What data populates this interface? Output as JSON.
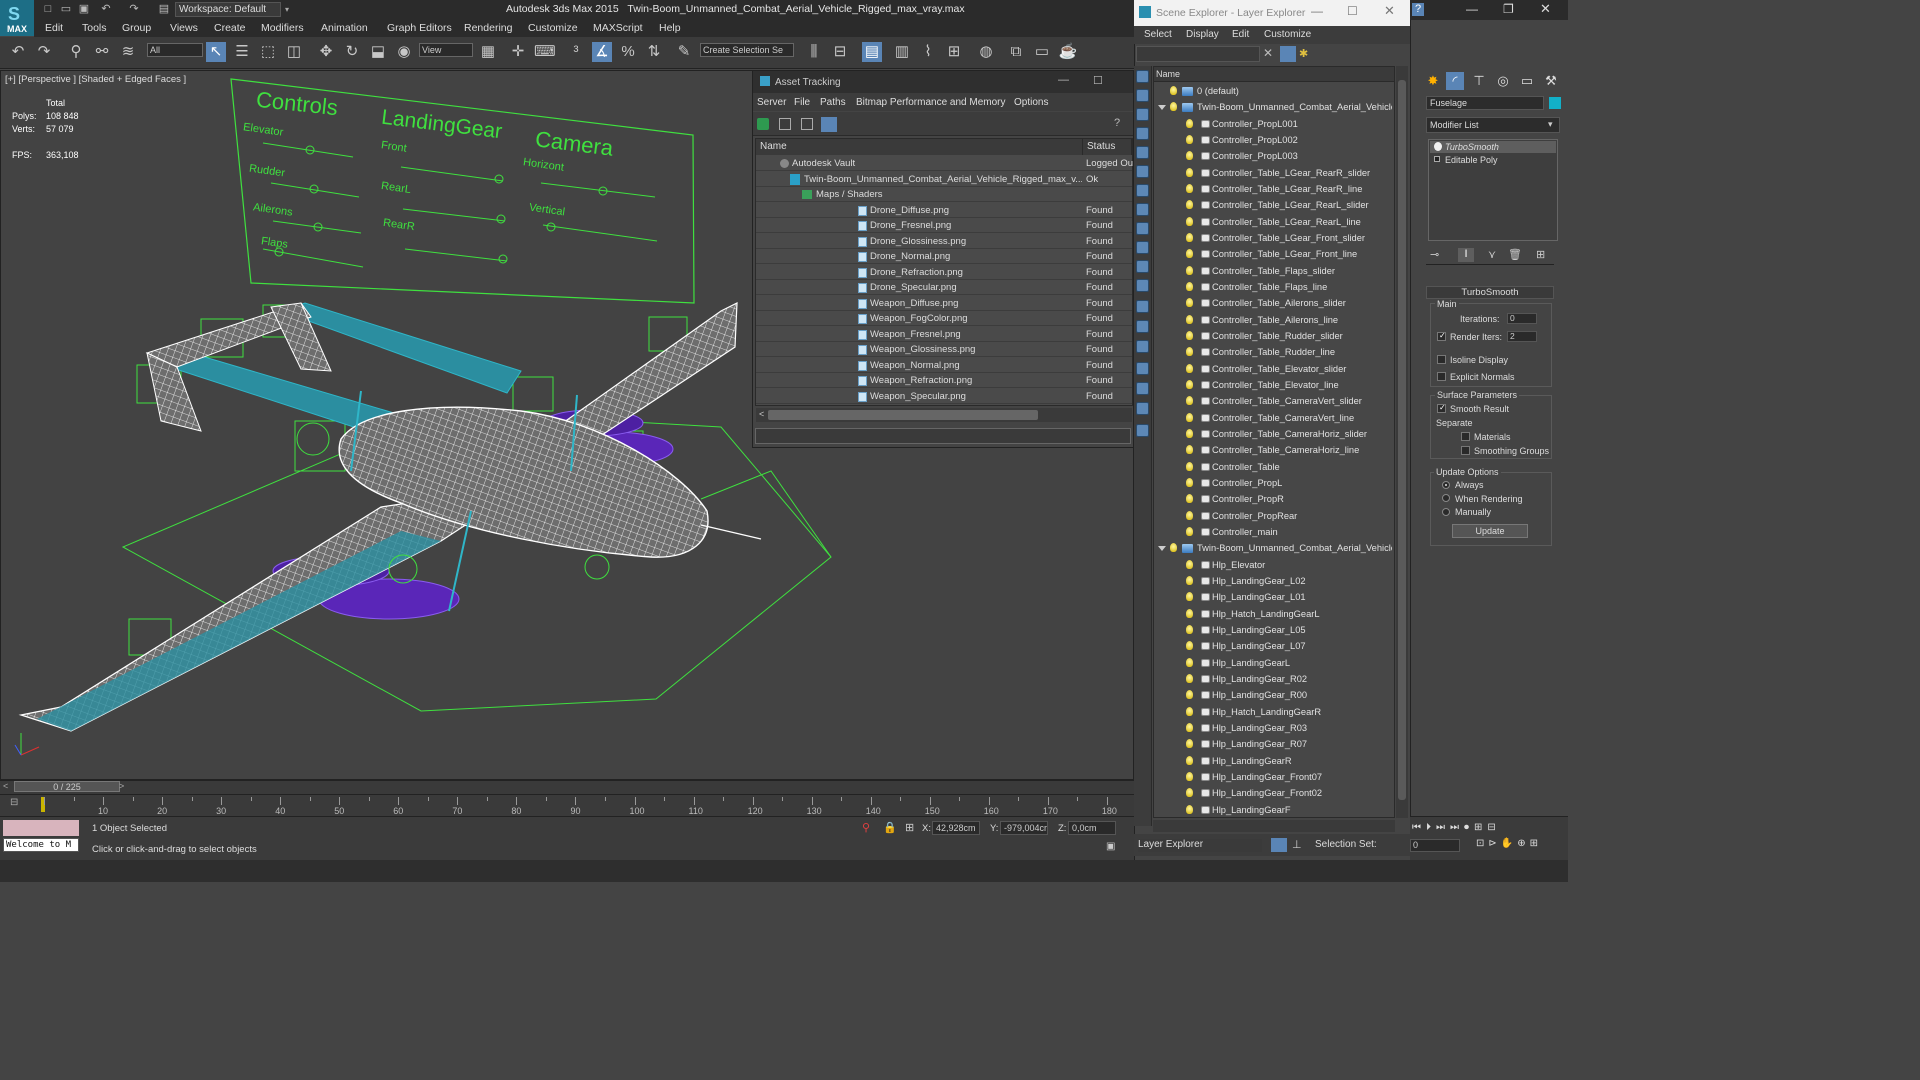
{
  "app": {
    "title": "Autodesk 3ds Max  2015",
    "file": "Twin-Boom_Unmanned_Combat_Aerial_Vehicle_Rigged_max_vray.max",
    "logo": "MAX",
    "workspace": "Workspace: Default"
  },
  "menu": [
    "Edit",
    "Tools",
    "Group",
    "Views",
    "Create",
    "Modifiers",
    "Animation",
    "Graph Editors",
    "Rendering",
    "Customize",
    "MAXScript",
    "Help"
  ],
  "toolbar": {
    "selection_filter": "All",
    "ref_coord": "View",
    "named_selection": "Create Selection Se"
  },
  "viewport": {
    "label": "[+] [Perspective ] [Shaded + Edged Faces ]",
    "stats": {
      "total_label": "Total",
      "polys_label": "Polys:",
      "polys": "108 848",
      "verts_label": "Verts:",
      "verts": "57 079",
      "fps_label": "FPS:",
      "fps": "363,108"
    },
    "controls": {
      "controls_title": "Controls",
      "landing_title": "LandingGear",
      "camera_title": "Camera",
      "elevator": "Elevator",
      "rudder": "Rudder",
      "ailerons": "Ailerons",
      "flaps": "Flaps",
      "front": "Front",
      "rearl": "RearL",
      "rearr": "RearR",
      "horizont": "Horizont",
      "vertical": "Vertical"
    }
  },
  "timeline": {
    "frame": "0 / 225",
    "ticks": [
      "10",
      "20",
      "30",
      "40",
      "50",
      "60",
      "70",
      "80",
      "90",
      "100",
      "110",
      "120",
      "130",
      "140",
      "150",
      "160",
      "170",
      "180"
    ]
  },
  "status": {
    "welcome": "Welcome to M",
    "selected": "1 Object Selected",
    "prompt": "Click or click-and-drag to select objects",
    "x_label": "X:",
    "x": "42,928cm",
    "y_label": "Y:",
    "y": "-979,004cr",
    "z_label": "Z:",
    "z": "0,0cm"
  },
  "asset_tracking": {
    "title": "Asset Tracking",
    "menu": [
      "Server",
      "File",
      "Paths",
      "Bitmap Performance and Memory",
      "Options"
    ],
    "col_name": "Name",
    "col_status": "Status",
    "rows": [
      {
        "name": "Autodesk Vault",
        "status": "Logged Ou",
        "indent": 0,
        "kind": "vault"
      },
      {
        "name": "Twin-Boom_Unmanned_Combat_Aerial_Vehicle_Rigged_max_v...",
        "status": "Ok",
        "indent": 1,
        "kind": "max"
      },
      {
        "name": "Maps / Shaders",
        "status": "",
        "indent": 2,
        "kind": "maps"
      },
      {
        "name": "Drone_Diffuse.png",
        "status": "Found",
        "indent": 3,
        "kind": "file"
      },
      {
        "name": "Drone_Fresnel.png",
        "status": "Found",
        "indent": 3,
        "kind": "file"
      },
      {
        "name": "Drone_Glossiness.png",
        "status": "Found",
        "indent": 3,
        "kind": "file"
      },
      {
        "name": "Drone_Normal.png",
        "status": "Found",
        "indent": 3,
        "kind": "file"
      },
      {
        "name": "Drone_Refraction.png",
        "status": "Found",
        "indent": 3,
        "kind": "file"
      },
      {
        "name": "Drone_Specular.png",
        "status": "Found",
        "indent": 3,
        "kind": "file"
      },
      {
        "name": "Weapon_Diffuse.png",
        "status": "Found",
        "indent": 3,
        "kind": "file"
      },
      {
        "name": "Weapon_FogColor.png",
        "status": "Found",
        "indent": 3,
        "kind": "file"
      },
      {
        "name": "Weapon_Fresnel.png",
        "status": "Found",
        "indent": 3,
        "kind": "file"
      },
      {
        "name": "Weapon_Glossiness.png",
        "status": "Found",
        "indent": 3,
        "kind": "file"
      },
      {
        "name": "Weapon_Normal.png",
        "status": "Found",
        "indent": 3,
        "kind": "file"
      },
      {
        "name": "Weapon_Refraction.png",
        "status": "Found",
        "indent": 3,
        "kind": "file"
      },
      {
        "name": "Weapon_Specular.png",
        "status": "Found",
        "indent": 3,
        "kind": "file"
      }
    ]
  },
  "scene_explorer": {
    "title": "Scene Explorer - Layer Explorer",
    "menu": [
      "Select",
      "Display",
      "Edit",
      "Customize"
    ],
    "col_name": "Name",
    "footer_label": "Layer Explorer",
    "selection_set_label": "Selection Set:",
    "rows": [
      {
        "name": "0 (default)",
        "kind": "layer",
        "indent": 0,
        "expand": false
      },
      {
        "name": "Twin-Boom_Unmanned_Combat_Aerial_Vehicle_Ri",
        "kind": "layer",
        "indent": 0,
        "expand": true
      },
      {
        "name": "Controller_PropL001",
        "kind": "obj",
        "indent": 1
      },
      {
        "name": "Controller_PropL002",
        "kind": "obj",
        "indent": 1
      },
      {
        "name": "Controller_PropL003",
        "kind": "obj",
        "indent": 1
      },
      {
        "name": "Controller_Table_LGear_RearR_slider",
        "kind": "obj",
        "indent": 1
      },
      {
        "name": "Controller_Table_LGear_RearR_line",
        "kind": "obj",
        "indent": 1
      },
      {
        "name": "Controller_Table_LGear_RearL_slider",
        "kind": "obj",
        "indent": 1
      },
      {
        "name": "Controller_Table_LGear_RearL_line",
        "kind": "obj",
        "indent": 1
      },
      {
        "name": "Controller_Table_LGear_Front_slider",
        "kind": "obj",
        "indent": 1
      },
      {
        "name": "Controller_Table_LGear_Front_line",
        "kind": "obj",
        "indent": 1
      },
      {
        "name": "Controller_Table_Flaps_slider",
        "kind": "obj",
        "indent": 1
      },
      {
        "name": "Controller_Table_Flaps_line",
        "kind": "obj",
        "indent": 1
      },
      {
        "name": "Controller_Table_Ailerons_slider",
        "kind": "obj",
        "indent": 1
      },
      {
        "name": "Controller_Table_Ailerons_line",
        "kind": "obj",
        "indent": 1
      },
      {
        "name": "Controller_Table_Rudder_slider",
        "kind": "obj",
        "indent": 1
      },
      {
        "name": "Controller_Table_Rudder_line",
        "kind": "obj",
        "indent": 1
      },
      {
        "name": "Controller_Table_Elevator_slider",
        "kind": "obj",
        "indent": 1
      },
      {
        "name": "Controller_Table_Elevator_line",
        "kind": "obj",
        "indent": 1
      },
      {
        "name": "Controller_Table_CameraVert_slider",
        "kind": "obj",
        "indent": 1
      },
      {
        "name": "Controller_Table_CameraVert_line",
        "kind": "obj",
        "indent": 1
      },
      {
        "name": "Controller_Table_CameraHoriz_slider",
        "kind": "obj",
        "indent": 1
      },
      {
        "name": "Controller_Table_CameraHoriz_line",
        "kind": "obj",
        "indent": 1
      },
      {
        "name": "Controller_Table",
        "kind": "obj",
        "indent": 1
      },
      {
        "name": "Controller_PropL",
        "kind": "obj",
        "indent": 1
      },
      {
        "name": "Controller_PropR",
        "kind": "obj",
        "indent": 1
      },
      {
        "name": "Controller_PropRear",
        "kind": "obj",
        "indent": 1
      },
      {
        "name": "Controller_main",
        "kind": "obj",
        "indent": 1
      },
      {
        "name": "Twin-Boom_Unmanned_Combat_Aerial_Vehicle_Ri",
        "kind": "layer",
        "indent": 0,
        "expand": true
      },
      {
        "name": "Hlp_Elevator",
        "kind": "obj",
        "indent": 1
      },
      {
        "name": "Hlp_LandingGear_L02",
        "kind": "obj",
        "indent": 1
      },
      {
        "name": "Hlp_LandingGear_L01",
        "kind": "obj",
        "indent": 1
      },
      {
        "name": "Hlp_Hatch_LandingGearL",
        "kind": "obj",
        "indent": 1
      },
      {
        "name": "Hlp_LandingGear_L05",
        "kind": "obj",
        "indent": 1
      },
      {
        "name": "Hlp_LandingGear_L07",
        "kind": "obj",
        "indent": 1
      },
      {
        "name": "Hlp_LandingGearL",
        "kind": "obj",
        "indent": 1
      },
      {
        "name": "Hlp_LandingGear_R02",
        "kind": "obj",
        "indent": 1
      },
      {
        "name": "Hlp_LandingGear_R00",
        "kind": "obj",
        "indent": 1
      },
      {
        "name": "Hlp_Hatch_LandingGearR",
        "kind": "obj",
        "indent": 1
      },
      {
        "name": "Hlp_LandingGear_R03",
        "kind": "obj",
        "indent": 1
      },
      {
        "name": "Hlp_LandingGear_R07",
        "kind": "obj",
        "indent": 1
      },
      {
        "name": "Hlp_LandingGearR",
        "kind": "obj",
        "indent": 1
      },
      {
        "name": "Hlp_LandingGear_Front07",
        "kind": "obj",
        "indent": 1
      },
      {
        "name": "Hlp_LandingGear_Front02",
        "kind": "obj",
        "indent": 1
      },
      {
        "name": "Hlp_LandingGearF",
        "kind": "obj",
        "indent": 1
      }
    ]
  },
  "command_panel": {
    "object_name": "Fuselage",
    "object_color": "#12b0c8",
    "modifier_list": "Modifier List",
    "stack": [
      "TurboSmooth",
      "Editable Poly"
    ],
    "turbosmooth": {
      "title": "TurboSmooth",
      "main": "Main",
      "iterations_label": "Iterations:",
      "iterations": "0",
      "render_iters_label": "Render Iters:",
      "render_iters": "2",
      "isoline": "Isoline Display",
      "explicit": "Explicit Normals",
      "surface": "Surface Parameters",
      "smooth_result": "Smooth Result",
      "separate": "Separate",
      "materials": "Materials",
      "smoothing_groups": "Smoothing Groups",
      "update_options": "Update Options",
      "always": "Always",
      "when_rendering": "When Rendering",
      "manually": "Manually",
      "update": "Update"
    },
    "frame_field": "0"
  },
  "colors": {
    "wire": "#ffffff",
    "helper": "#3fe03f",
    "boom": "#2fb6c8",
    "weapon": "#6a2fd0",
    "accent": "#5a85b6"
  }
}
